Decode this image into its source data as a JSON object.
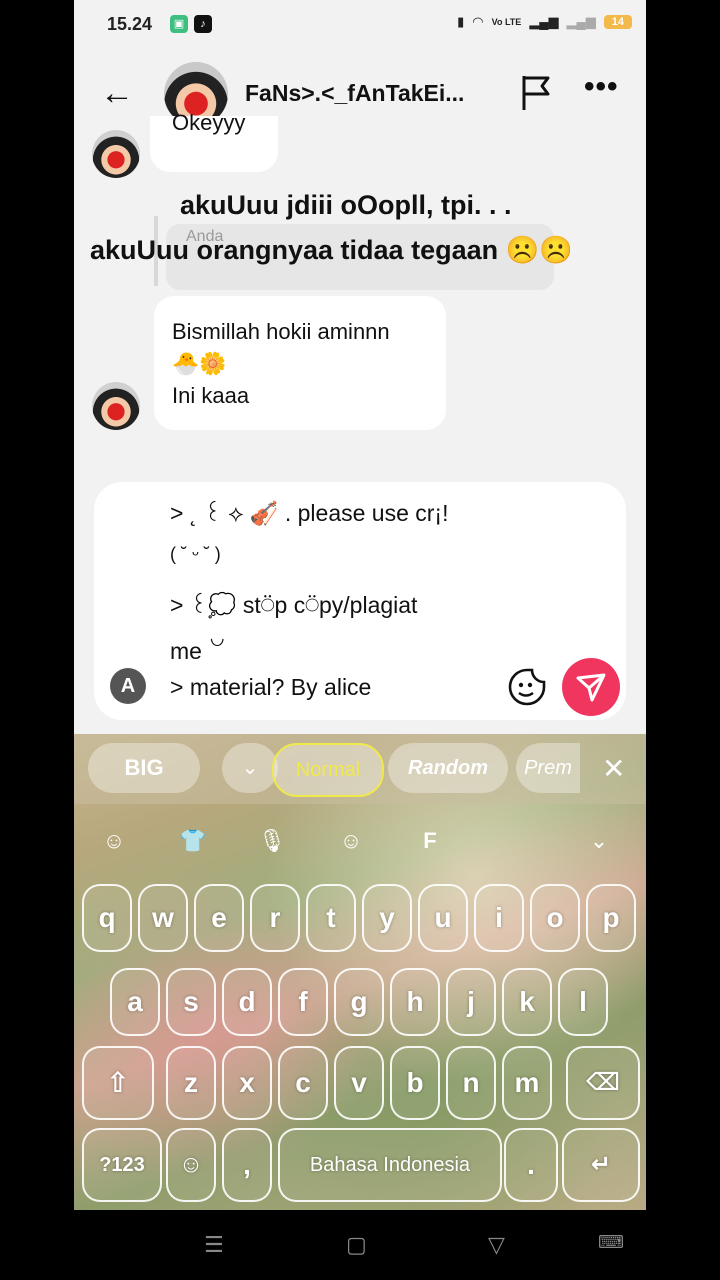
{
  "status": {
    "time": "15.24",
    "battery": "14",
    "signal_label": "Vo LTE"
  },
  "header": {
    "title": "FaNs>.<_fAnTakEi..."
  },
  "messages": {
    "m1": "Okeyyy",
    "overlay_line1": "akuUuu jdiii oOopll, tpi. . .",
    "overlay_line2": "akuUuu orangnyaa tidaa tegaan ☹️☹️",
    "reply_label": "Anda",
    "m2_line1": "Bismillah hokii aminnn",
    "m2_line2": "🐣🌼",
    "m2_line3": "Ini kaaa"
  },
  "input": {
    "line1": "> ˛ ꒰ ⟡ 🎻 . please use cr¡!",
    "line2": "( ˘ ᵕ ˘ )",
    "line3": "> ꒰💭 st⍥p c⍥py/plagiat",
    "line4": "me ꒡",
    "line5": "> material? By alice",
    "mode_icon": "A"
  },
  "keyboard": {
    "font_pills": [
      "BIG",
      "Normal",
      "Random",
      "Prem"
    ],
    "close": "✕",
    "row1": [
      "q",
      "w",
      "e",
      "r",
      "t",
      "y",
      "u",
      "i",
      "o",
      "p"
    ],
    "row2": [
      "a",
      "s",
      "d",
      "f",
      "g",
      "h",
      "j",
      "k",
      "l"
    ],
    "row3": [
      "z",
      "x",
      "c",
      "v",
      "b",
      "n",
      "m"
    ],
    "num_key": "?123",
    "space_label": "Bahasa Indonesia",
    "colors": {
      "accent": "#f0365e",
      "selected_pill": "#f0e94a"
    }
  }
}
